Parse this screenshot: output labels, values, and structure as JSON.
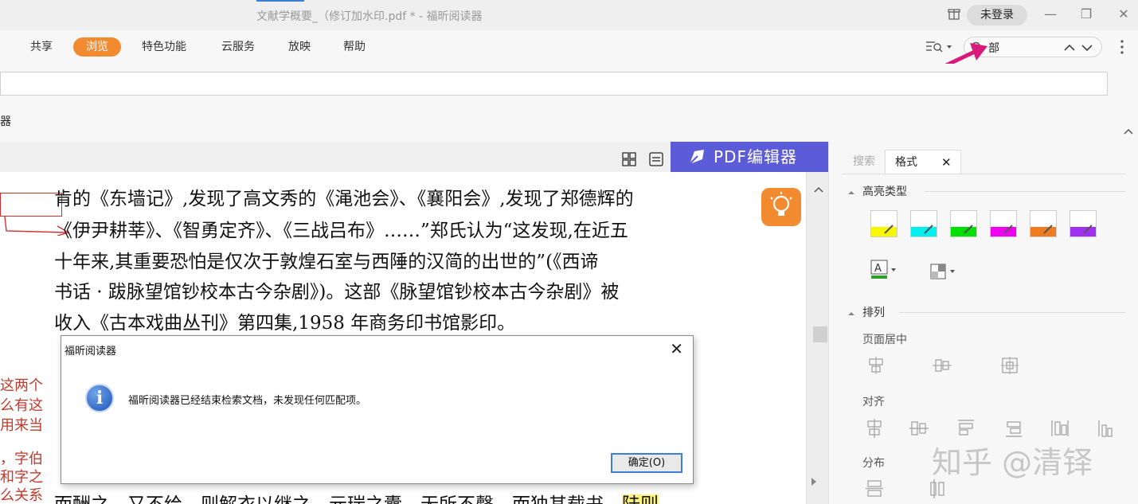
{
  "window": {
    "title": "文献学概要_（修订加水印.pdf * - 福昕阅读器",
    "login_label": "未登录",
    "minimize_glyph": "—",
    "restore_glyph": "❐",
    "close_glyph": "✕"
  },
  "menu": {
    "items": [
      "共享",
      "浏览",
      "特色功能",
      "云服务",
      "放映",
      "帮助"
    ],
    "active": "浏览"
  },
  "search": {
    "value": "部"
  },
  "toolbar": {
    "partial_label": "器"
  },
  "document": {
    "banner": "PDF编辑器",
    "lines": [
      "肯的《东墙记》,发现了高文秀的《渑池会》、《襄阳会》,发现了郑德辉的",
      "《伊尹耕莘》、《智勇定齐》、《三战吕布》……”郑氏认为“这发现,在近五",
      "十年来,其重要恐怕是仅次于敦煌石室与西陲的汉简的出世的”(《西谛",
      "书话 · 跋脉望馆钞校本古今杂剧》)。这部《脉望馆钞校本古今杂剧》被",
      "收入《古本戏曲丛刊》第四集,1958 年商务印书馆影印。"
    ],
    "bottom_line_prefix": "而酬之。又不给，则解衣以继之。元瑞之囊，无所不罄，而独其载书，",
    "bottom_line_highlight": "陆则",
    "margin_notes": [
      "这两个",
      "么有这",
      "用来当",
      "，字伯",
      "和字之",
      "么关系"
    ]
  },
  "panel": {
    "tabs": [
      "搜索",
      "格式"
    ],
    "active_tab": "格式",
    "close_glyph": "✕",
    "highlight_type_title": "高亮类型",
    "highlight_colors": [
      "#f7f700",
      "#00f0f0",
      "#00e000",
      "#f000f0",
      "#f07a20",
      "#a030f0"
    ],
    "arrange_title": "排列",
    "page_center_label": "页面居中",
    "align_label": "对齐",
    "distribute_label": "分布"
  },
  "dialog": {
    "title": "福昕阅读器",
    "message": "福昕阅读器已经结束检索文档，未发现任何匹配项。",
    "ok_label": "确定(O)",
    "close_glyph": "✕"
  },
  "watermark": "知乎 @清铎",
  "colors": {
    "accent": "#f28a2f",
    "banner": "#5c5cd8",
    "arrow": "#d81b7a"
  }
}
